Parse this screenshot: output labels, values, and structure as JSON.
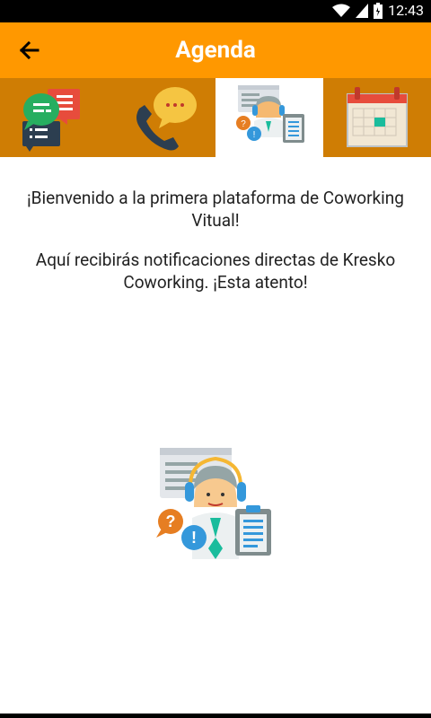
{
  "status": {
    "time": "12:43"
  },
  "header": {
    "title": "Agenda"
  },
  "tabs": [
    {
      "icon": "chat-bubbles-icon"
    },
    {
      "icon": "phone-call-icon"
    },
    {
      "icon": "support-agent-icon",
      "selected": true
    },
    {
      "icon": "calendar-icon"
    }
  ],
  "main": {
    "welcome": "¡Bienvenido a la primera plataforma de Coworking Vitual!",
    "notice": "Aquí recibirás notificaciones directas de Kresko Coworking. ¡Esta atento!"
  },
  "colors": {
    "primary": "#ff9800",
    "tab_bg": "#cf7d04"
  }
}
